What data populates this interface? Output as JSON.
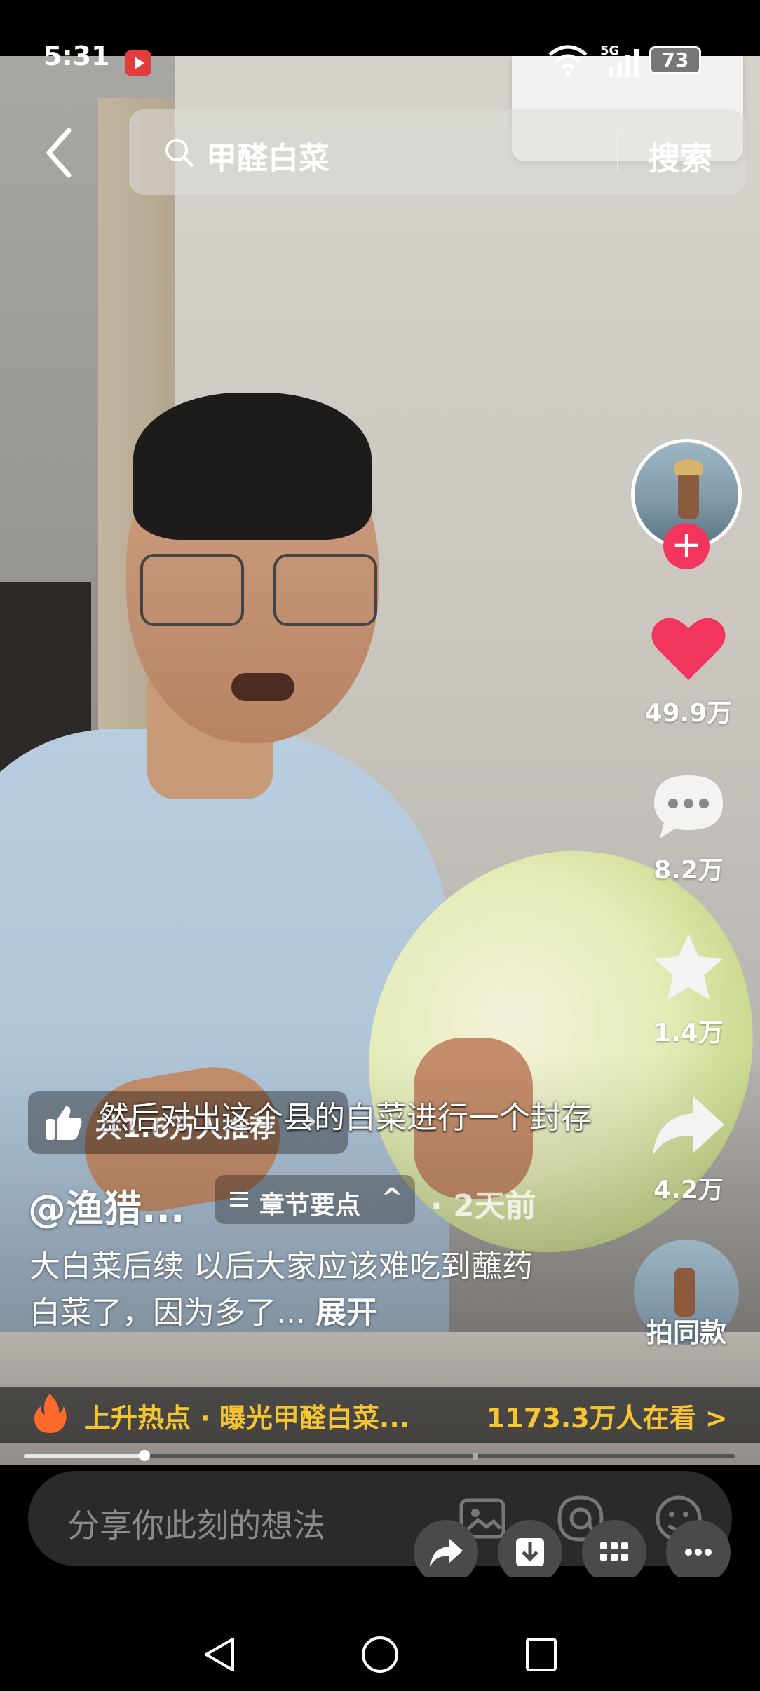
{
  "status_bar": {
    "time": "5:31",
    "network": "5G",
    "battery": "73"
  },
  "search": {
    "query": "甲醛白菜",
    "button_label": "搜索"
  },
  "actions": {
    "likes": "49.9万",
    "comments": "8.2万",
    "favorites": "1.4万",
    "shares": "4.2万",
    "same_style": "拍同款"
  },
  "video": {
    "recommend": "共1.6万人推荐",
    "subtitle": "然后对出这个县的白菜进行一个封存",
    "author": "@渔猎...",
    "chapter_label": "章节要点",
    "post_time": "· 2天前",
    "description": "大白菜后续 以后大家应该难吃到蘸药白菜了，因为多了...",
    "expand_label": "展开",
    "progress": 0.17
  },
  "hot_topic": {
    "text": "上升热点 · 曝光甲醛白菜...",
    "viewers": "1173.3万人在看 >"
  },
  "comment_input": {
    "placeholder": "分享你此刻的想法"
  },
  "colors": {
    "like": "#f2355c",
    "hot": "#f7c531",
    "follow": "#f2355c"
  },
  "icons": [
    "back-icon",
    "search-icon",
    "like-icon",
    "comment-icon",
    "star-icon",
    "share-icon",
    "thumb-icon",
    "flame-icon",
    "image-icon",
    "at-icon",
    "emoji-icon",
    "forward-icon",
    "download-icon",
    "grid-icon",
    "more-icon"
  ]
}
